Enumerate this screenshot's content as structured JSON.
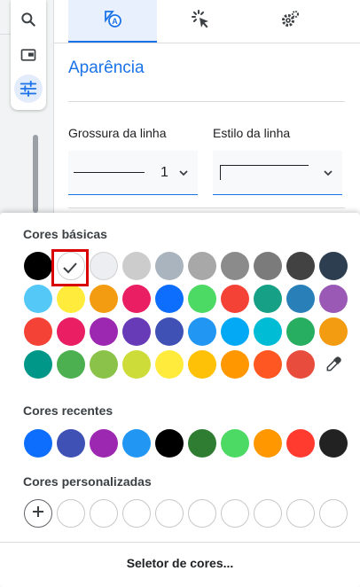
{
  "toolbar": {
    "tools": [
      {
        "icon": "search-icon"
      },
      {
        "icon": "picture-in-picture-icon"
      },
      {
        "icon": "sliders-icon",
        "active": true
      }
    ]
  },
  "panel": {
    "tabs": [
      {
        "icon": "format-shape-icon",
        "active": true
      },
      {
        "icon": "click-cursor-icon",
        "active": false
      },
      {
        "icon": "settings-gear-icon",
        "active": false
      }
    ],
    "section_title": "Aparência",
    "line_thickness_label": "Grossura da linha",
    "line_thickness_value": "1",
    "line_style_label": "Estilo da linha"
  },
  "colors": {
    "basic_title": "Cores básicas",
    "basic": [
      [
        "#000000",
        "#ffffff",
        "#eceef1",
        "#cccccc",
        "#aab4be",
        "#a8a8a8",
        "#8b8b8b",
        "#7b7b7b",
        "#424242",
        "#2c3e50"
      ],
      [
        "#54c8f7",
        "#ffeb3b",
        "#f39c12",
        "#e91e63",
        "#0d6efd",
        "#4cd964",
        "#f44336",
        "#16a085",
        "#2980b9",
        "#9b59b6"
      ],
      [
        "#f44336",
        "#e91e63",
        "#9c27b0",
        "#673ab7",
        "#3f51b5",
        "#2196f3",
        "#03a9f4",
        "#00bcd4",
        "#27ae60",
        "#f39c12"
      ],
      [
        "#009688",
        "#4caf50",
        "#8bc34a",
        "#cddc39",
        "#ffeb3b",
        "#ffc107",
        "#ff9800",
        "#ff5722",
        "#e74c3c"
      ]
    ],
    "selected_color": "#ffffff",
    "eyedropper_icon": "eyedropper-icon",
    "recent_title": "Cores recentes",
    "recent": [
      "#0d6efd",
      "#3f51b5",
      "#9c27b0",
      "#2196f3",
      "#000000",
      "#2e7d32",
      "#4cd964",
      "#ff9800",
      "#ff3b30",
      "#222222"
    ],
    "custom_title": "Cores personalizadas",
    "custom_empty_count": 9,
    "add_icon": "plus-icon",
    "picker_button": "Seletor de cores..."
  }
}
